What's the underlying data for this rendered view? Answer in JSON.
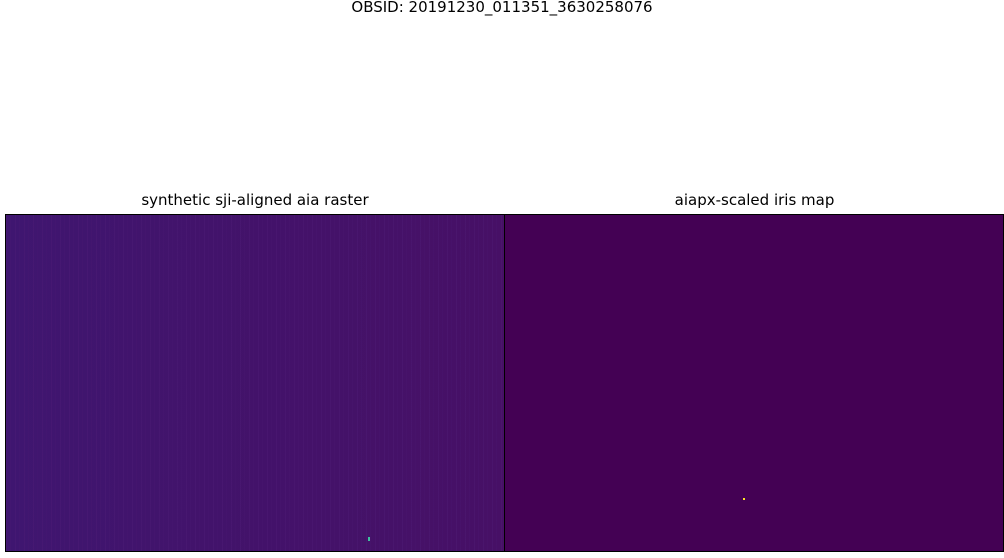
{
  "figure": {
    "suptitle": "OBSID: 20191230_011351_3630258076"
  },
  "panels": [
    {
      "title": "synthetic sji-aligned aia raster",
      "colormap": "viridis",
      "base_color": "#43136a",
      "highlight_color": "#3fbfa0"
    },
    {
      "title": "aiapx-scaled iris map",
      "colormap": "viridis",
      "base_color": "#440154",
      "highlight_color": "#fde725"
    }
  ]
}
